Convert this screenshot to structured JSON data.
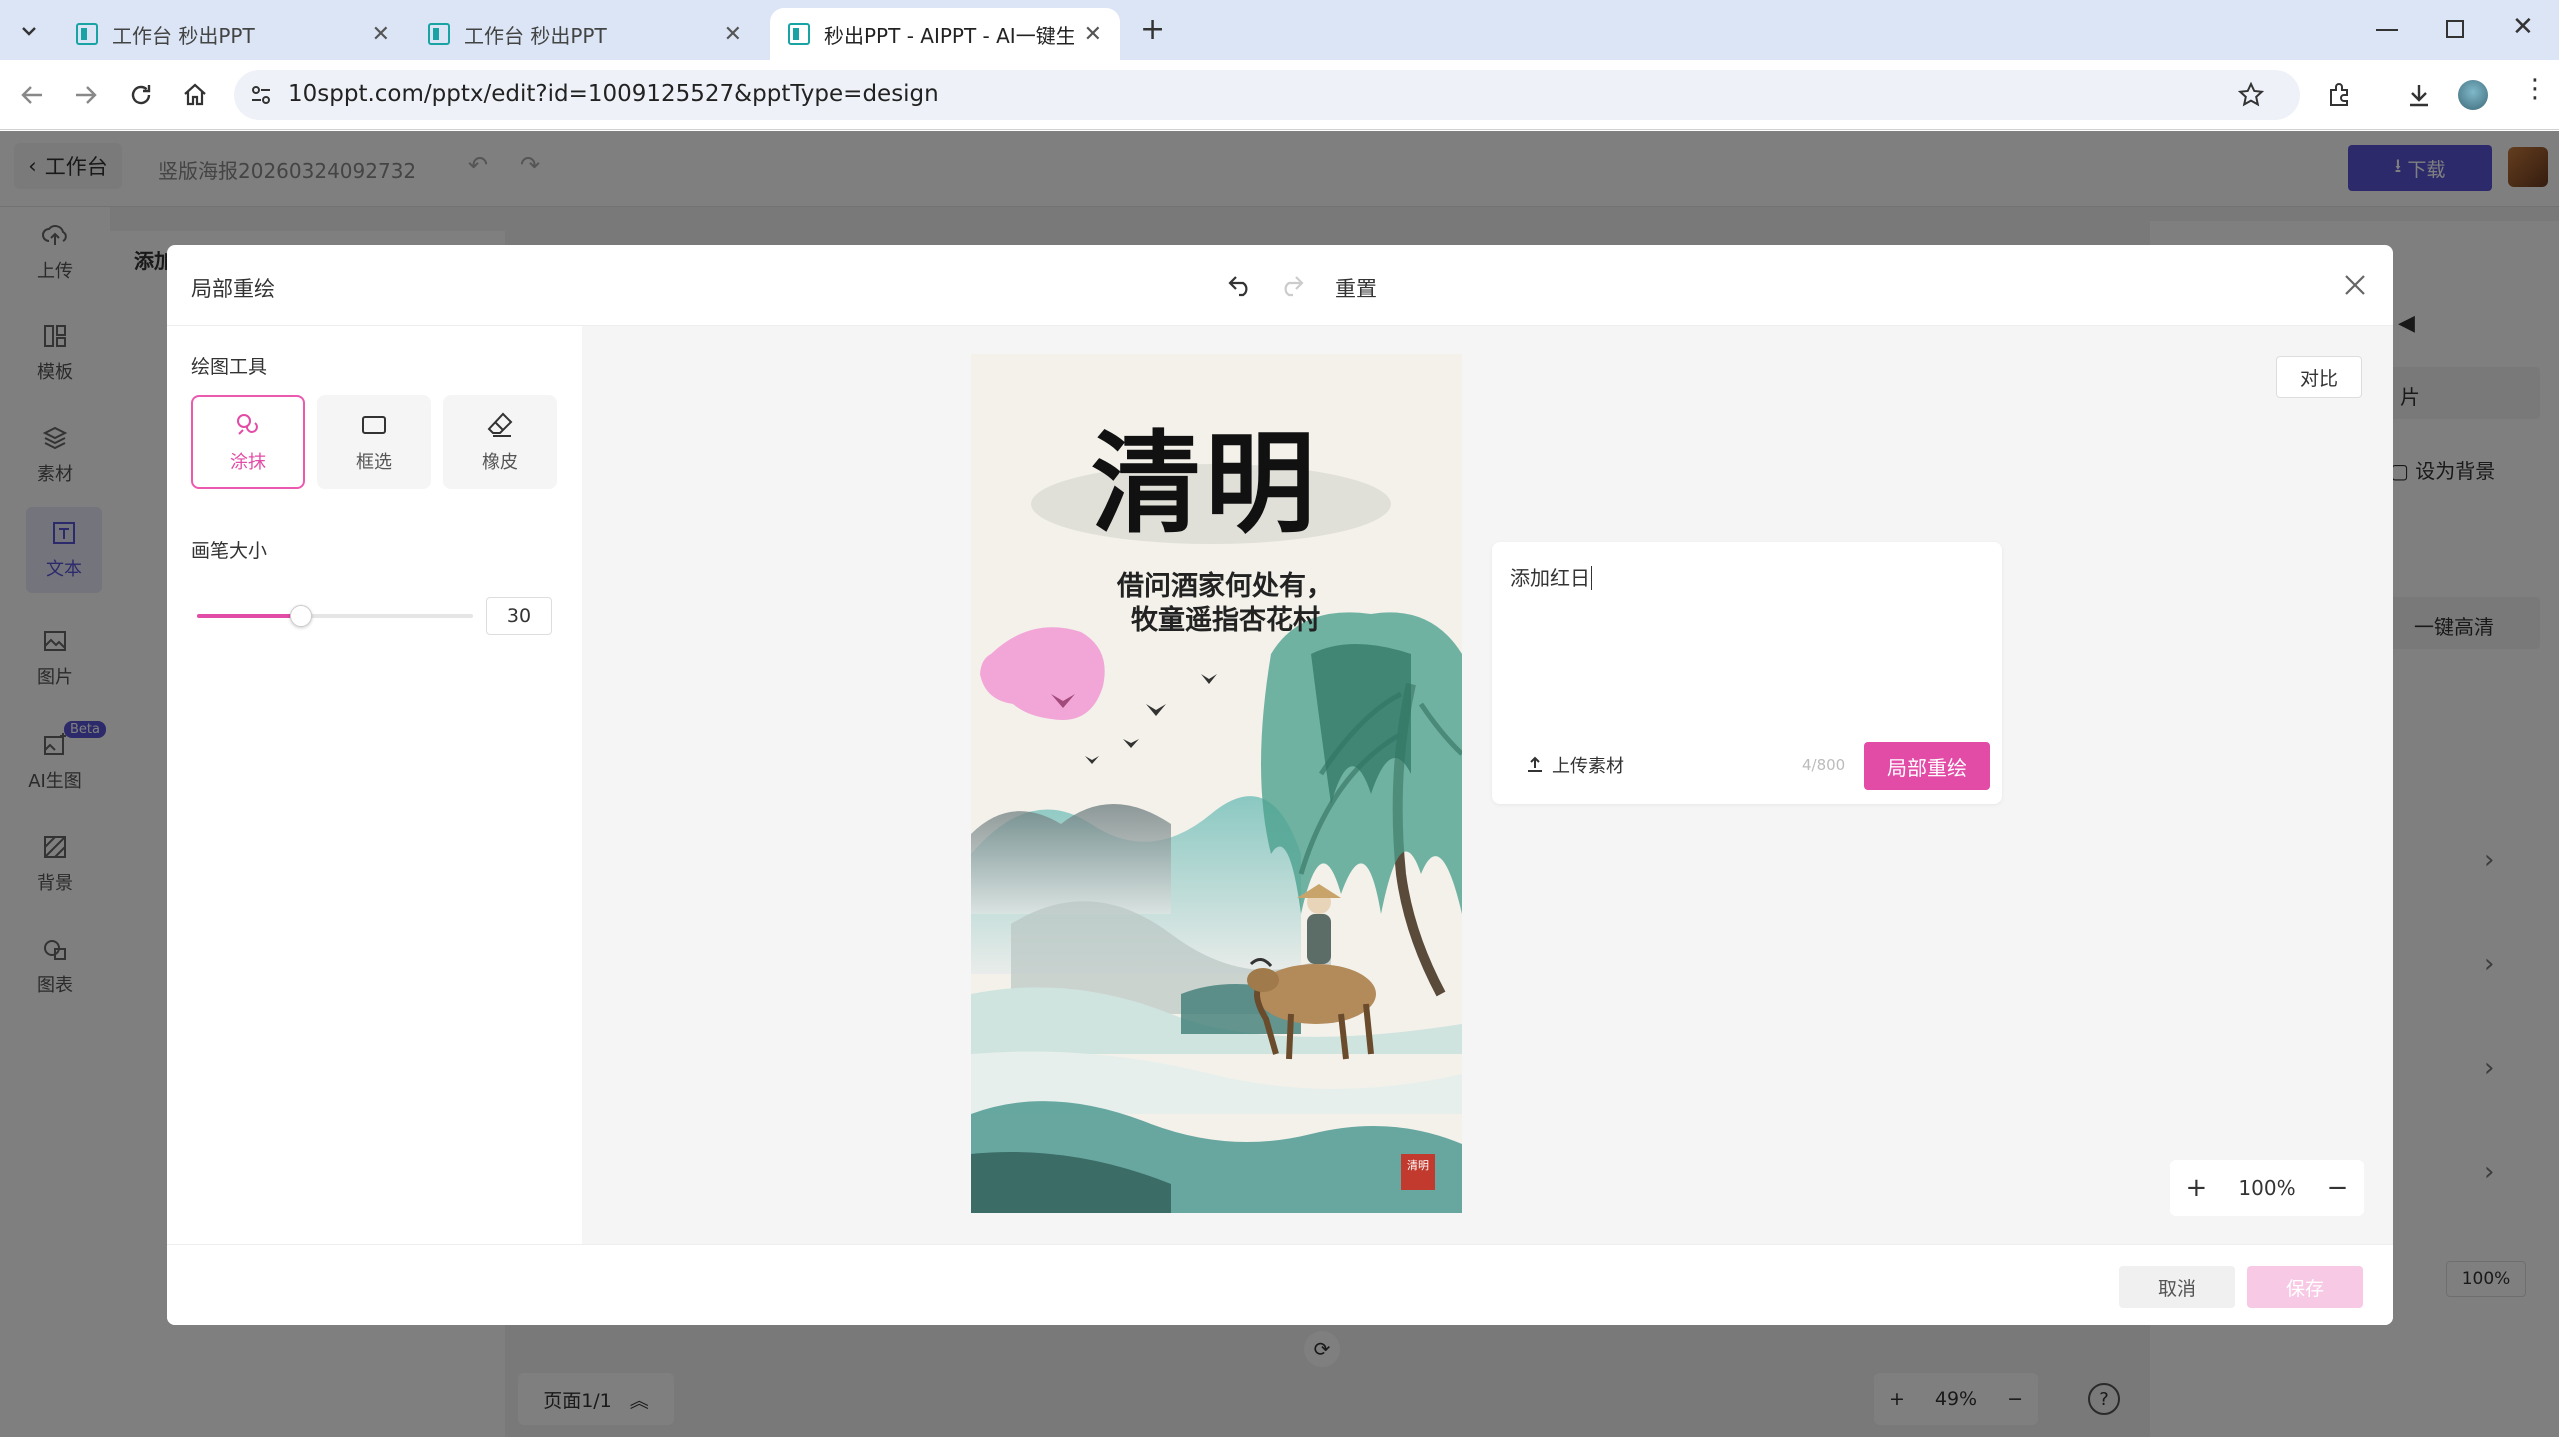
{
  "browser": {
    "tabs": [
      {
        "title": "工作台 秒出PPT"
      },
      {
        "title": "工作台 秒出PPT"
      },
      {
        "title": "秒出PPT - AIPPT - AI一键生成"
      }
    ],
    "url": "10sppt.com/pptx/edit?id=1009125527&pptType=design"
  },
  "app": {
    "back_label": "工作台",
    "doc_title": "竖版海报20260324092732",
    "download_label": "下载",
    "nav": [
      {
        "label": "上传",
        "icon": "upload-icon"
      },
      {
        "label": "模板",
        "icon": "template-icon"
      },
      {
        "label": "素材",
        "icon": "layers-icon"
      },
      {
        "label": "文本",
        "icon": "text-icon"
      },
      {
        "label": "图片",
        "icon": "image-icon"
      },
      {
        "label": "AI生图",
        "icon": "ai-image-icon",
        "badge": "Beta"
      },
      {
        "label": "背景",
        "icon": "background-icon"
      },
      {
        "label": "图表",
        "icon": "chart-icon"
      }
    ],
    "left_panel_title": "添加",
    "right_panel": {
      "item_pian": "片",
      "set_bg": "设为背景",
      "hd": "一键高清",
      "zoom": "100%"
    },
    "page_indicator": "页面1/1",
    "zoom": "49%"
  },
  "modal": {
    "title": "局部重绘",
    "reset_label": "重置",
    "tools_label": "绘图工具",
    "tools": [
      {
        "label": "涂抹",
        "icon": "brush-icon",
        "selected": true
      },
      {
        "label": "框选",
        "icon": "rectangle-icon",
        "selected": false
      },
      {
        "label": "橡皮",
        "icon": "eraser-icon",
        "selected": false
      }
    ],
    "brush_size_label": "画笔大小",
    "brush_size": "30",
    "compare_label": "对比",
    "prompt_text": "添加红日",
    "upload_label": "上传素材",
    "char_count": "4/800",
    "repaint_button": "局部重绘",
    "zoom": "100%",
    "cancel_label": "取消",
    "save_label": "保存"
  },
  "poster": {
    "title": "清明",
    "poem_line1": "借问酒家何处有，",
    "poem_line2": "牧童遥指杏花村",
    "seal_text": "清明"
  },
  "colors": {
    "accent_pink": "#e24ba6",
    "brand_purple": "#5b55d6",
    "mask_pink": "#f2a6d8"
  }
}
